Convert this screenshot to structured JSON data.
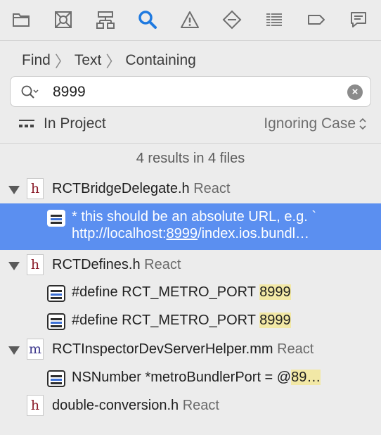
{
  "toolbar": {
    "icons": [
      "folder-icon",
      "source-control-icon",
      "hierarchy-icon",
      "search-icon",
      "warning-icon",
      "breakpoint-diamond-icon",
      "report-list-icon",
      "label-tag-icon",
      "message-bubble-icon"
    ],
    "active_color": "#1f7ae0"
  },
  "breadcrumb": {
    "mode": "Find",
    "kind": "Text",
    "match": "Containing"
  },
  "search": {
    "value": "8999"
  },
  "scope": {
    "label": "In Project",
    "case_option": "Ignoring Case"
  },
  "summary": "4 results in 4 files",
  "results": [
    {
      "file": "RCTBridgeDelegate.h",
      "project": "React",
      "type": "h",
      "matches": [
        {
          "line1": "* this should be an absolute URL, e.g. `",
          "line2_before": "http://localhost:",
          "line2_match": "8999",
          "line2_after": "/index.ios.bundl…"
        }
      ]
    },
    {
      "file": "RCTDefines.h",
      "project": "React",
      "type": "h",
      "matches": [
        {
          "before": "#define RCT_METRO_PORT ",
          "match": "8999"
        },
        {
          "before": "#define RCT_METRO_PORT ",
          "match": "8999"
        }
      ]
    },
    {
      "file": "RCTInspectorDevServerHelper.mm",
      "project": "React",
      "type": "m",
      "matches": [
        {
          "before": "NSNumber *metroBundlerPort = @",
          "match": "89…"
        }
      ]
    },
    {
      "file": "double-conversion.h",
      "project": "React",
      "type": "h",
      "matches": []
    }
  ]
}
